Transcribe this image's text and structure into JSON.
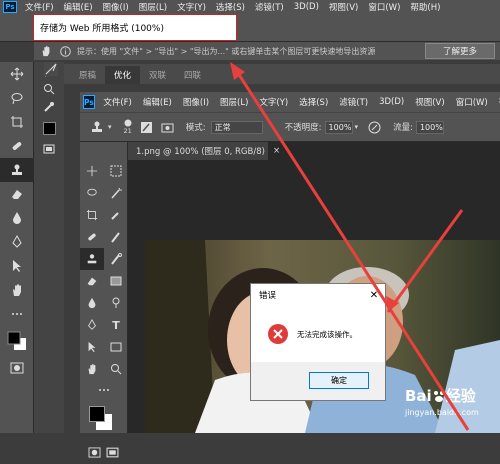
{
  "outer_app": {
    "logo": "Ps",
    "menu": [
      "文件(F)",
      "编辑(E)",
      "图像(I)",
      "图层(L)",
      "文字(Y)",
      "选择(S)",
      "滤镜(T)",
      "3D(D)",
      "视图(V)",
      "窗口(W)",
      "帮助(H)"
    ]
  },
  "save_for_web": {
    "title": "存储为 Web 所用格式 (100%)",
    "info_text": "提示：使用 \"文件\" > \"导出\" > \"导出为...\" 或右键单击某个图层可更快速地导出资源",
    "learn_more": "了解更多",
    "tabs": [
      "原稿",
      "优化",
      "双联",
      "四联"
    ],
    "active_tab": 1
  },
  "inner_ps": {
    "logo": "Ps",
    "menu": [
      "文件(F)",
      "编辑(E)",
      "图像(I)",
      "图层(L)",
      "文字(Y)",
      "选择(S)",
      "滤镜(T)",
      "3D(D)",
      "视图(V)",
      "窗口(W)",
      "帮助"
    ],
    "options": {
      "brush_size": "21",
      "mode_label": "模式:",
      "mode_value": "正常",
      "opacity_label": "不透明度:",
      "opacity_value": "100%",
      "flow_label": "流量:",
      "flow_value": "100%"
    },
    "doc_tab": "1.png @ 100% (图层 0, RGB/8)"
  },
  "error_dialog": {
    "title": "错误",
    "close": "✕",
    "message": "无法完成该操作。",
    "ok": "确定"
  },
  "watermark": {
    "brand": "Bai",
    "brand2": "经验",
    "url": "jingyan.baidu.com"
  },
  "colors": {
    "accent": "#e03b3b",
    "arrow": "#e8403c",
    "ui_gray": "#535353"
  }
}
